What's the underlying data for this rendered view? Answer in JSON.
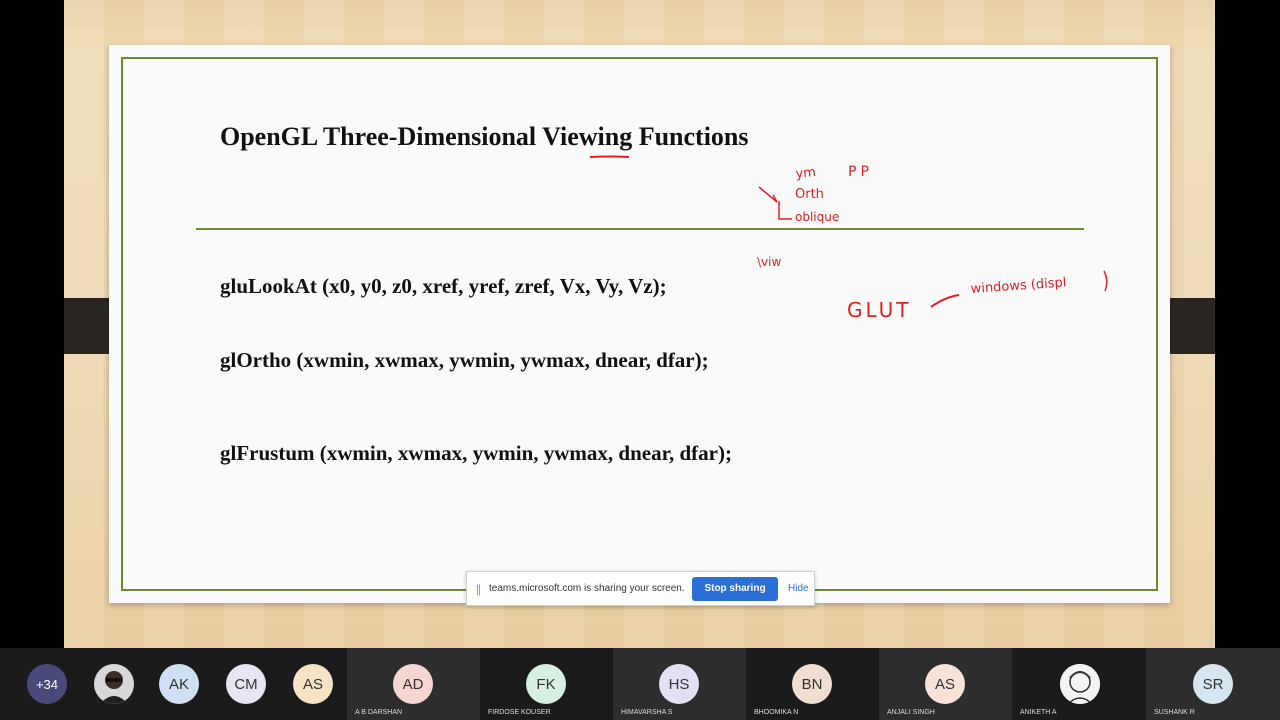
{
  "slide": {
    "title": "OpenGL Three-Dimensional Viewing Functions",
    "lines": [
      "gluLookAt (x0, y0, z0, xref, yref, zref, Vx, Vy, Vz);",
      "glOrtho (xwmin, xwmax, ywmin, ywmax, dnear, dfar);",
      "glFrustum (xwmin, xwmax, ywmin, ywmax, dnear, dfar);"
    ]
  },
  "annotations": {
    "color": "#e02020",
    "notes": [
      "ym",
      "PP",
      "Orth",
      "oblique",
      "\\viw",
      "GLUT",
      "windows (displ",
      "— "
    ]
  },
  "share_bar": {
    "message": "teams.microsoft.com is sharing your screen.",
    "stop_label": "Stop sharing",
    "hide_label": "Hide",
    "grip": "||"
  },
  "participants": {
    "overflow_count": "+34",
    "people": [
      {
        "initials": "",
        "name": "",
        "color": "#555555",
        "photo": true
      },
      {
        "initials": "AK",
        "name": "",
        "color": "#cfe0f4"
      },
      {
        "initials": "CM",
        "name": "",
        "color": "#e6e6f2"
      },
      {
        "initials": "AS",
        "name": "",
        "color": "#f6e2c4"
      },
      {
        "initials": "AD",
        "name": "A B DARSHAN",
        "color": "#f6d6d0"
      },
      {
        "initials": "FK",
        "name": "FIRDOSE KOUSER",
        "color": "#d6efe0"
      },
      {
        "initials": "HS",
        "name": "HIMAVARSHA S",
        "color": "#e2e0f4"
      },
      {
        "initials": "BN",
        "name": "BHOOMIKA N",
        "color": "#f2ded0"
      },
      {
        "initials": "AS",
        "name": "ANJALI SINGH",
        "color": "#f6e2d6"
      },
      {
        "initials": "",
        "name": "ANIKETH A",
        "color": "#f0f0f0",
        "photo": true
      },
      {
        "initials": "SR",
        "name": "SUSHANK R",
        "color": "#d6e6f0"
      }
    ]
  }
}
